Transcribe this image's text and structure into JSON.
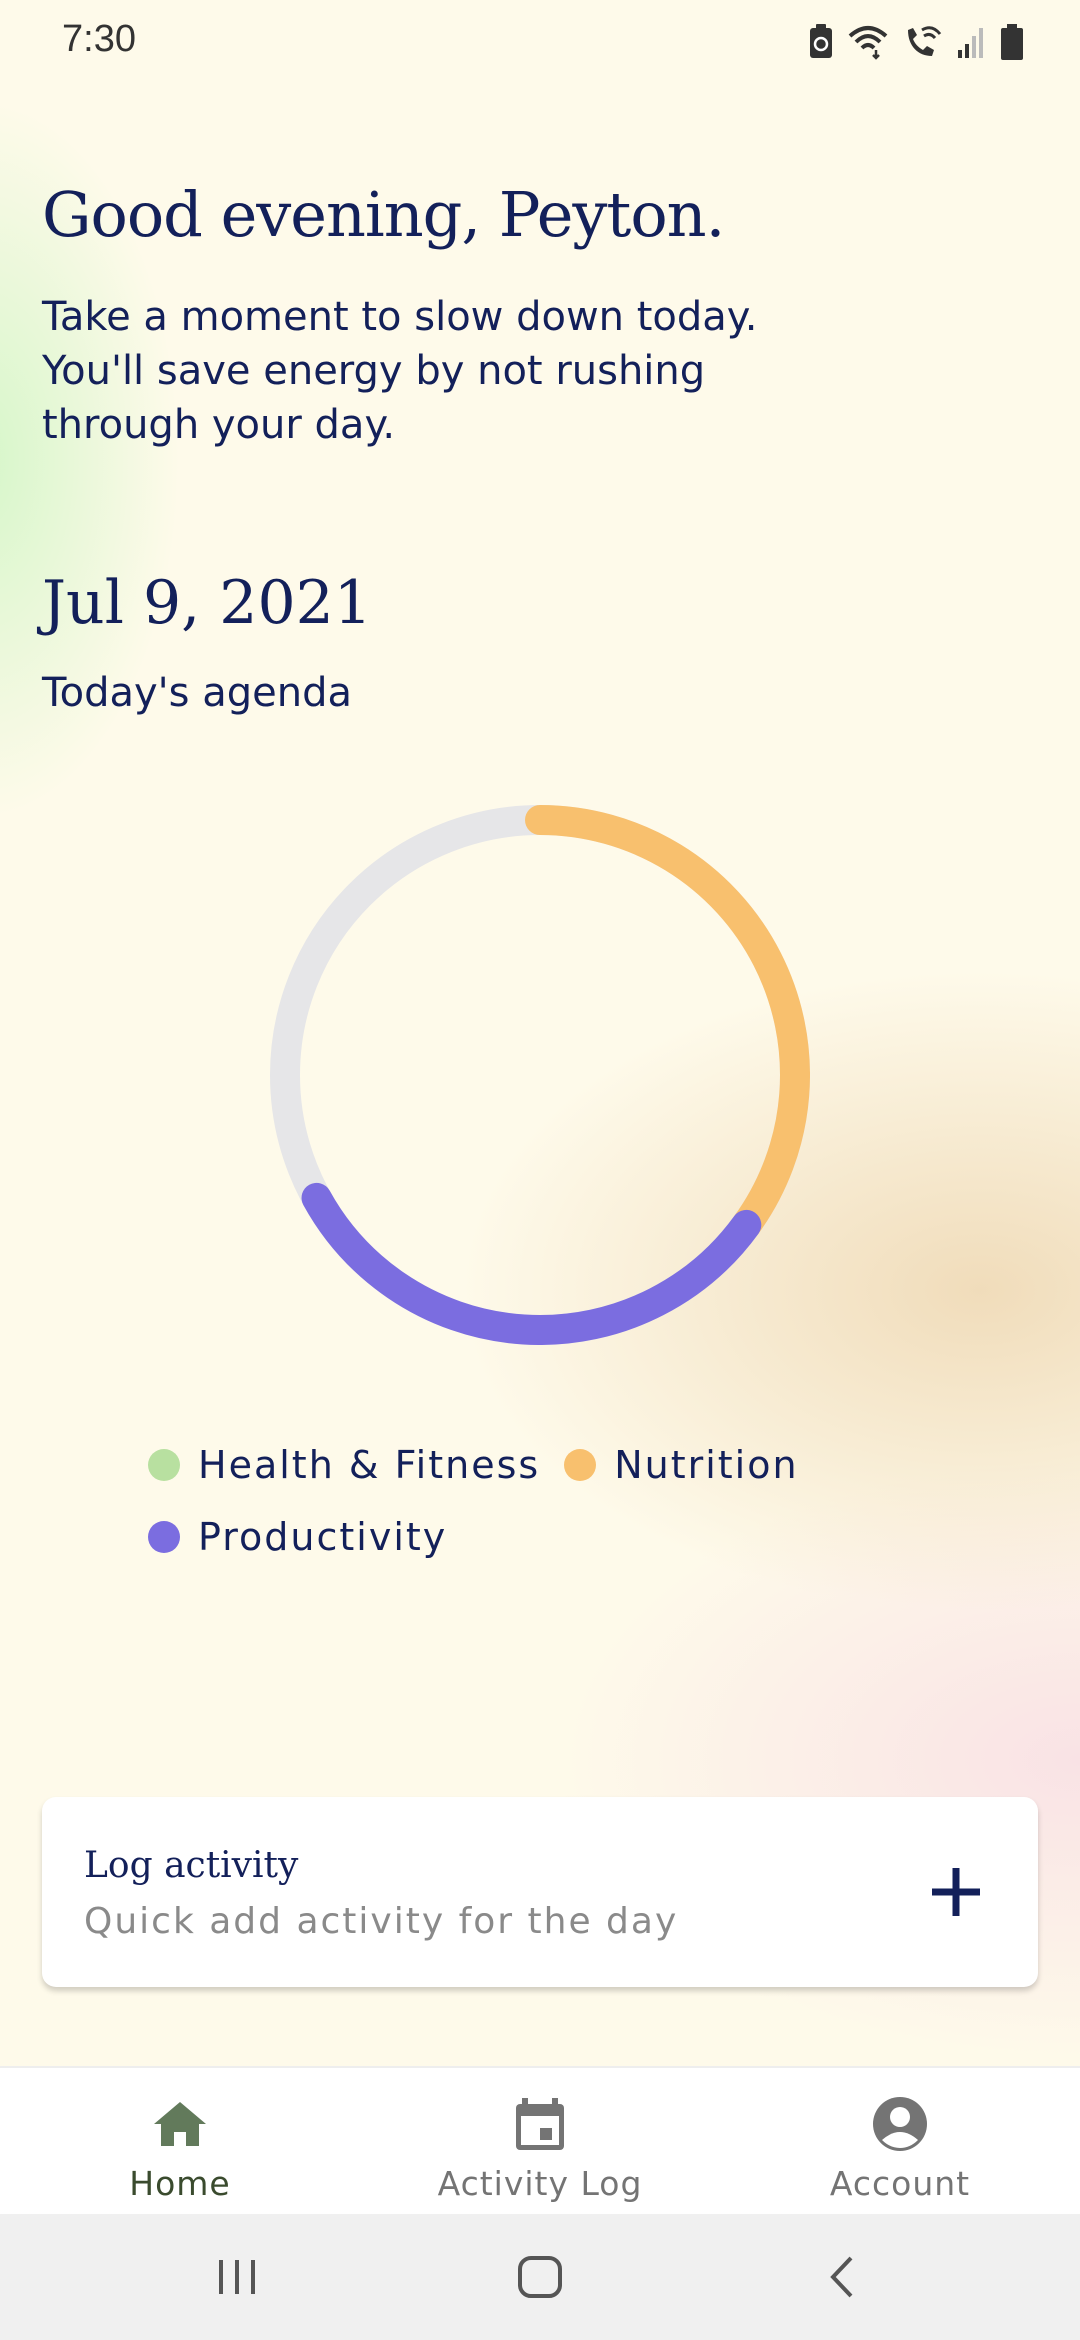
{
  "status_bar": {
    "time": "7:30",
    "icons": [
      "battery-saver-icon",
      "wifi-icon",
      "wifi-calling-icon",
      "signal-icon",
      "battery-icon"
    ]
  },
  "greeting": {
    "title": "Good evening, Peyton.",
    "message": "Take a moment to slow down today. You'll save energy by not rushing through your day."
  },
  "agenda": {
    "date": "Jul 9, 2021",
    "label": "Today's agenda"
  },
  "chart_data": {
    "type": "pie",
    "style": "donut-ring",
    "segments": [
      {
        "name": "Health & Fitness",
        "value": 0,
        "color": "#b8e0a0"
      },
      {
        "name": "Nutrition",
        "value": 0.35,
        "color": "#f8c06e"
      },
      {
        "name": "Productivity",
        "value": 0.32,
        "color": "#7b6de0"
      }
    ],
    "remaining_color": "#e6e6e8"
  },
  "legend": {
    "items": [
      {
        "label": "Health & Fitness",
        "color": "#b8e0a0"
      },
      {
        "label": "Nutrition",
        "color": "#f8c06e"
      },
      {
        "label": "Productivity",
        "color": "#7b6de0"
      }
    ]
  },
  "log_card": {
    "title": "Log activity",
    "subtitle": "Quick add activity for the day",
    "action_icon": "plus-icon"
  },
  "bottom_nav": {
    "items": [
      {
        "label": "Home",
        "icon": "home-icon",
        "active": true
      },
      {
        "label": "Activity Log",
        "icon": "calendar-icon",
        "active": false
      },
      {
        "label": "Account",
        "icon": "account-icon",
        "active": false
      }
    ]
  },
  "system_nav": {
    "buttons": [
      "recent-apps-icon",
      "home-button-icon",
      "back-icon"
    ]
  },
  "colors": {
    "text_primary": "#13205a",
    "text_secondary": "#8a8a8a",
    "nav_active": "#627a5b",
    "nav_inactive": "#747474"
  }
}
